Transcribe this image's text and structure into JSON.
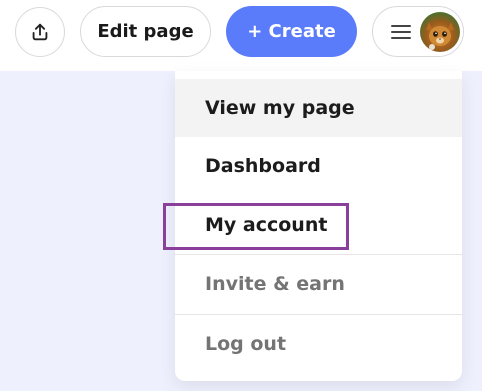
{
  "header": {
    "share_icon": "share-upload-icon",
    "edit_page_label": "Edit page",
    "create_label": "+ Create",
    "menu_icon": "hamburger-icon",
    "avatar_icon": "user-avatar"
  },
  "dropdown": {
    "items": [
      {
        "label": "View my page"
      },
      {
        "label": "Dashboard"
      },
      {
        "label": "My account"
      },
      {
        "label": "Invite & earn"
      },
      {
        "label": "Log out"
      }
    ]
  },
  "colors": {
    "accent": "#5b7cfa",
    "page_background": "#eef0fe",
    "highlight_border": "#8a3f9a"
  }
}
